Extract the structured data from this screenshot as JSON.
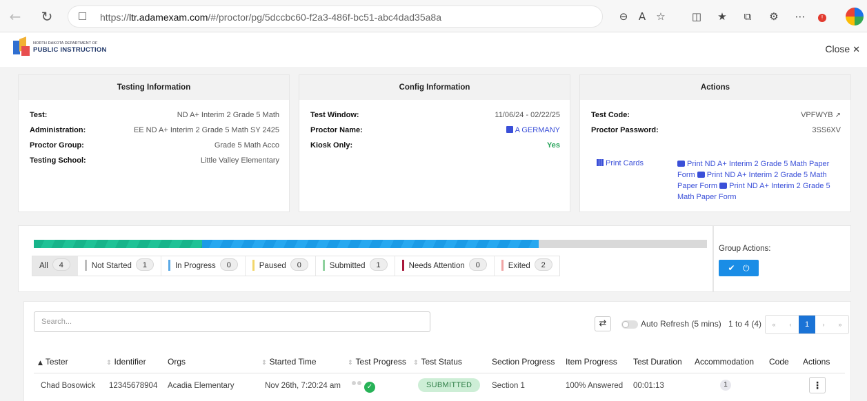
{
  "browser": {
    "url_prefix": "https://",
    "url_host": "ltr.adamexam.com",
    "url_path": "/#/proctor/pg/5dccbc60-f2a3-486f-bc51-abc4dad35a8a"
  },
  "header": {
    "logo_line1": "NORTH DAKOTA DEPARTMENT OF",
    "logo_line2": "PUBLIC INSTRUCTION",
    "close_label": "Close"
  },
  "testing_info": {
    "title": "Testing Information",
    "rows": [
      {
        "label": "Test:",
        "value": "ND A+ Interim 2 Grade 5 Math"
      },
      {
        "label": "Administration:",
        "value": "EE ND A+ Interim 2 Grade 5 Math SY 2425"
      },
      {
        "label": "Proctor Group:",
        "value": "Grade 5 Math Acco"
      },
      {
        "label": "Testing School:",
        "value": "Little Valley Elementary"
      }
    ]
  },
  "config_info": {
    "title": "Config Information",
    "test_window_label": "Test Window:",
    "test_window_value": "11/06/24 - 02/22/25",
    "proctor_name_label": "Proctor Name:",
    "proctor_name_value": "A GERMANY",
    "kiosk_label": "Kiosk Only:",
    "kiosk_value": "Yes"
  },
  "actions_card": {
    "title": "Actions",
    "test_code_label": "Test Code:",
    "test_code_value": "VPFWYB",
    "password_label": "Proctor Password:",
    "password_value": "3SS6XV",
    "print_cards_label": "Print Cards",
    "print_forms": [
      "Print ND A+ Interim 2 Grade 5 Math Paper Form",
      "Print ND A+ Interim 2 Grade 5 Math Paper Form",
      "Print ND A+ Interim 2 Grade 5 Math Paper Form"
    ]
  },
  "progress": {
    "total": 4,
    "submitted_fraction": 0.25,
    "exited_fraction": 0.5,
    "filters": [
      {
        "label": "All",
        "count": "4",
        "color": ""
      },
      {
        "label": "Not Started",
        "count": "1",
        "color": "#bdbdbd"
      },
      {
        "label": "In Progress",
        "count": "0",
        "color": "#5aa9e6"
      },
      {
        "label": "Paused",
        "count": "0",
        "color": "#f2d66b"
      },
      {
        "label": "Submitted",
        "count": "1",
        "color": "#8fd19e"
      },
      {
        "label": "Needs Attention",
        "count": "0",
        "color": "#a8173a"
      },
      {
        "label": "Exited",
        "count": "2",
        "color": "#f0a4a4"
      }
    ]
  },
  "group_actions": {
    "title": "Group Actions:"
  },
  "table": {
    "search_placeholder": "Search...",
    "auto_refresh_label": "Auto Refresh (5 mins)",
    "range_label": "1 to 4 (4)",
    "current_page": "1",
    "columns": [
      "Tester",
      "Identifier",
      "Orgs",
      "Started Time",
      "Test Progress",
      "Test Status",
      "Section Progress",
      "Item Progress",
      "Test Duration",
      "Accommodation",
      "Code",
      "Actions"
    ],
    "rows": [
      {
        "tester": "Chad Bosowick",
        "identifier": "12345678904",
        "orgs": "Acadia Elementary",
        "started": "Nov 26th, 7:20:24 am",
        "status": "SUBMITTED",
        "section": "Section 1",
        "item": "100% Answered",
        "duration": "00:01:13",
        "accommodation": "1"
      }
    ]
  }
}
